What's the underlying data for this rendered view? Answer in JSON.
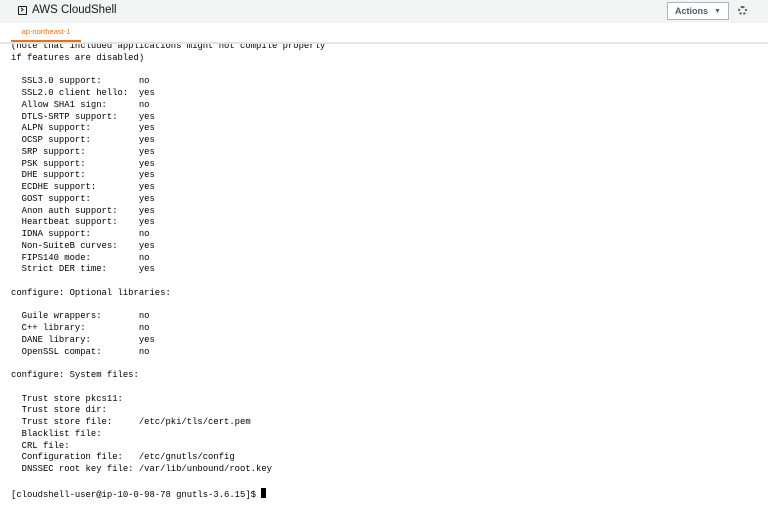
{
  "header": {
    "title": "AWS CloudShell",
    "actions_label": "Actions",
    "actions_caret": "▼"
  },
  "tabs": [
    {
      "label": "ap-northeast-1",
      "active": true
    }
  ],
  "terminal": {
    "lines": [
      "(note that included applications might not compile properly",
      "if features are disabled)",
      "",
      "  SSL3.0 support:       no",
      "  SSL2.0 client hello:  yes",
      "  Allow SHA1 sign:      no",
      "  DTLS-SRTP support:    yes",
      "  ALPN support:         yes",
      "  OCSP support:         yes",
      "  SRP support:          yes",
      "  PSK support:          yes",
      "  DHE support:          yes",
      "  ECDHE support:        yes",
      "  GOST support:         yes",
      "  Anon auth support:    yes",
      "  Heartbeat support:    yes",
      "  IDNA support:         no",
      "  Non-SuiteB curves:    yes",
      "  FIPS140 mode:         no",
      "  Strict DER time:      yes",
      "",
      "configure: Optional libraries:",
      "",
      "  Guile wrappers:       no",
      "  C++ library:          no",
      "  DANE library:         yes",
      "  OpenSSL compat:       no",
      "",
      "configure: System files:",
      "",
      "  Trust store pkcs11:",
      "  Trust store dir:",
      "  Trust store file:     /etc/pki/tls/cert.pem",
      "  Blacklist file:",
      "  CRL file:",
      "  Configuration file:   /etc/gnutls/config",
      "  DNSSEC root key file: /var/lib/unbound/root.key",
      ""
    ],
    "prompt": "[cloudshell-user@ip-10-0-98-78 gnutls-3.6.15]$ "
  }
}
